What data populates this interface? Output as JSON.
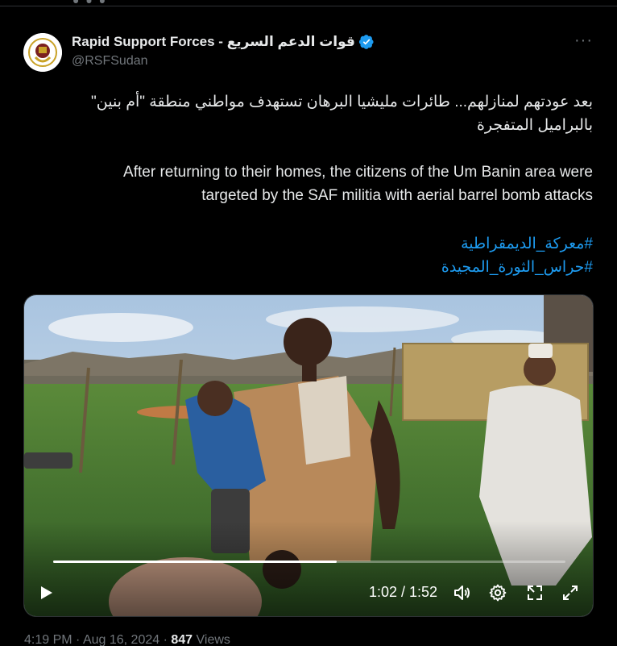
{
  "tweet": {
    "author_name": "Rapid Support Forces - قوات الدعم السريع",
    "author_handle": "@RSFSudan",
    "more_label": "···",
    "arabic_line1": "بعد عودتهم لمنازلهم... طائرات مليشيا البرهان تستهدف مواطني منطقة \"أم بنين\"",
    "arabic_line2": "بالبراميل المتفجرة",
    "english_line1": "After returning to their homes, the citizens of the Um Banin area were",
    "english_line2": "targeted by the SAF militia with aerial barrel bomb attacks",
    "hashtags": [
      "#معركة_الديمقراطية",
      "#حراس_الثورة_المجيدة"
    ]
  },
  "video": {
    "time_display": "1:02 / 1:52",
    "progress": 0.554
  },
  "meta": {
    "time": "4:19 PM",
    "separator": "·",
    "date": "Aug 16, 2024",
    "views_count": "847",
    "views_label": "Views"
  },
  "colors": {
    "accent": "#1d9bf0",
    "text": "#e7e9ea",
    "muted": "#71767b",
    "background": "#000000"
  },
  "icons": {
    "verified": "verified-badge-icon",
    "play": "play-icon",
    "volume": "volume-icon",
    "settings": "gear-icon",
    "pip": "picture-in-picture-icon",
    "fullscreen": "fullscreen-icon"
  }
}
